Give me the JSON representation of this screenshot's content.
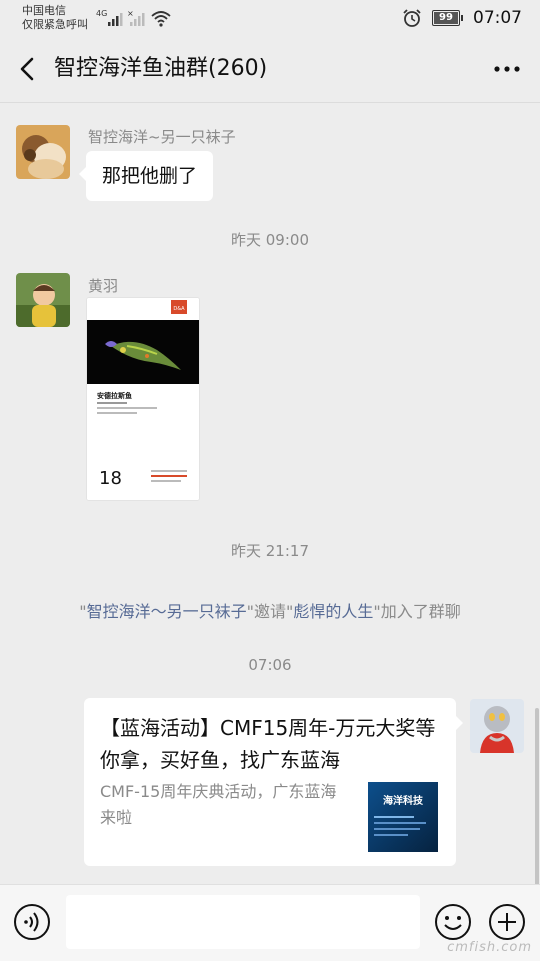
{
  "status_bar": {
    "carrier_line1": "中国电信",
    "carrier_line2": "仅限紧急呼叫",
    "network": "4G",
    "battery": "99",
    "battery_level_percent": 99,
    "time": "07:07"
  },
  "header": {
    "title": "智控海洋鱼油群(260)"
  },
  "messages": [
    {
      "sender": "智控海洋~另一只袜子",
      "text": "那把他删了"
    },
    {
      "sender": "黄羽",
      "image_card": {
        "name_cn": "安德拉斯鱼",
        "number": "18",
        "badge": "D&A"
      }
    }
  ],
  "timestamps": [
    "昨天 09:00",
    "昨天 21:17",
    "07:06"
  ],
  "system_message": {
    "quote_open": "\"",
    "inviter": "智控海洋～另一只袜子",
    "mid": "\"邀请\"",
    "invitee": "彪悍的人生",
    "end": "\"加入了群聊"
  },
  "link_card": {
    "title": "【蓝海活动】CMF15周年-万元大奖等你拿，买好鱼，找广东蓝海",
    "description": "CMF-15周年庆典活动，广东蓝海来啦",
    "thumb_text": "海洋科技"
  },
  "icons": {
    "back": "chevron-left-icon",
    "more": "more-dots-icon",
    "voice": "voice-icon",
    "emoji": "emoji-icon",
    "plus": "plus-icon",
    "alarm": "alarm-icon",
    "wifi": "wifi-icon"
  },
  "watermark": "cmfish.com",
  "colors": {
    "background": "#ededed",
    "link_name": "#576b95",
    "bubble": "#ffffff"
  }
}
